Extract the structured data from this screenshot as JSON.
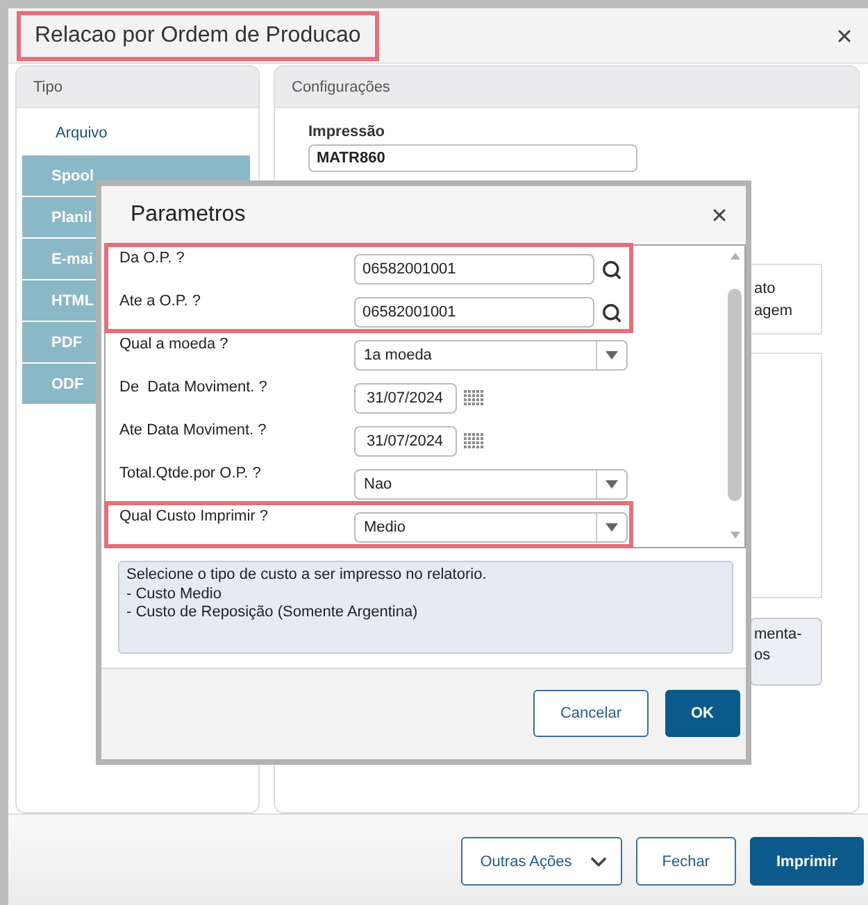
{
  "window": {
    "title": "Relacao por Ordem de Producao",
    "title_highlighted": true
  },
  "type_panel": {
    "heading": "Tipo",
    "items": [
      {
        "label": "Arquivo",
        "kind": "link"
      },
      {
        "label": "Spool",
        "kind": "option"
      },
      {
        "label": "Planil",
        "kind": "option"
      },
      {
        "label": "E-mai",
        "kind": "option"
      },
      {
        "label": "HTML",
        "kind": "option"
      },
      {
        "label": "PDF",
        "kind": "option"
      },
      {
        "label": "ODF",
        "kind": "option"
      }
    ]
  },
  "settings_panel": {
    "heading": "Configurações",
    "print_label": "Impressão",
    "print_value": "MATR860",
    "box_1": {
      "labels": [
        "ato",
        "agem"
      ]
    },
    "button_1": {
      "lines": [
        "menta-",
        "os"
      ]
    }
  },
  "params_dialog": {
    "title": "Parametros",
    "rows": [
      {
        "label": "Da O.P. ?",
        "kind": "lookup",
        "value": "06582001001",
        "highlighted": true
      },
      {
        "label": "Ate a O.P. ?",
        "kind": "lookup",
        "value": "06582001001",
        "highlighted": true
      },
      {
        "label": "Qual a moeda ?",
        "kind": "select",
        "value": "1a moeda",
        "highlighted": false
      },
      {
        "label": "De  Data Moviment. ?",
        "kind": "date",
        "value": "31/07/2024",
        "highlighted": false
      },
      {
        "label": "Ate Data Moviment. ?",
        "kind": "date",
        "value": "31/07/2024",
        "highlighted": false
      },
      {
        "label": "Total.Qtde.por O.P. ?",
        "kind": "select",
        "value": "Nao",
        "highlighted": false
      },
      {
        "label": "Qual Custo Imprimir ?",
        "kind": "select",
        "value": "Medio",
        "highlighted": true
      }
    ],
    "help": "Selecione o tipo de custo a ser impresso no relatorio.\n- Custo Medio\n- Custo de Reposição (Somente Argentina)",
    "buttons": [
      {
        "label": "Cancelar",
        "kind": "secondary"
      },
      {
        "label": "OK",
        "kind": "primary"
      }
    ]
  },
  "footer_buttons": [
    {
      "label": "Outras Ações",
      "kind": "menu"
    },
    {
      "label": "Fechar",
      "kind": "secondary"
    },
    {
      "label": "Imprimir",
      "kind": "primary"
    }
  ]
}
